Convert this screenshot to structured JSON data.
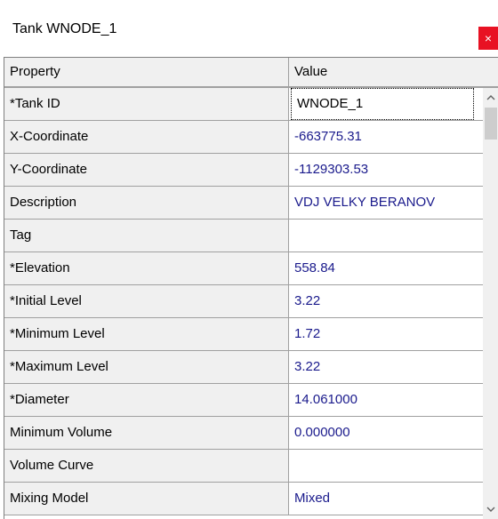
{
  "window": {
    "title": "Tank WNODE_1",
    "close_label": "×"
  },
  "grid": {
    "headers": {
      "property": "Property",
      "value": "Value"
    },
    "rows": [
      {
        "property": "*Tank ID",
        "value": "WNODE_1"
      },
      {
        "property": "X-Coordinate",
        "value": "-663775.31"
      },
      {
        "property": "Y-Coordinate",
        "value": "-1129303.53"
      },
      {
        "property": "Description",
        "value": "VDJ VELKY BERANOV"
      },
      {
        "property": "Tag",
        "value": ""
      },
      {
        "property": "*Elevation",
        "value": "558.84"
      },
      {
        "property": "*Initial Level",
        "value": "3.22"
      },
      {
        "property": "*Minimum Level",
        "value": "1.72"
      },
      {
        "property": "*Maximum Level",
        "value": "3.22"
      },
      {
        "property": "*Diameter",
        "value": "14.061000"
      },
      {
        "property": "Minimum Volume",
        "value": "0.000000"
      },
      {
        "property": "Volume Curve",
        "value": ""
      },
      {
        "property": "Mixing Model",
        "value": "Mixed"
      }
    ]
  },
  "scrollbar": {
    "up_icon": "chevron-up-icon",
    "down_icon": "chevron-down-icon"
  }
}
